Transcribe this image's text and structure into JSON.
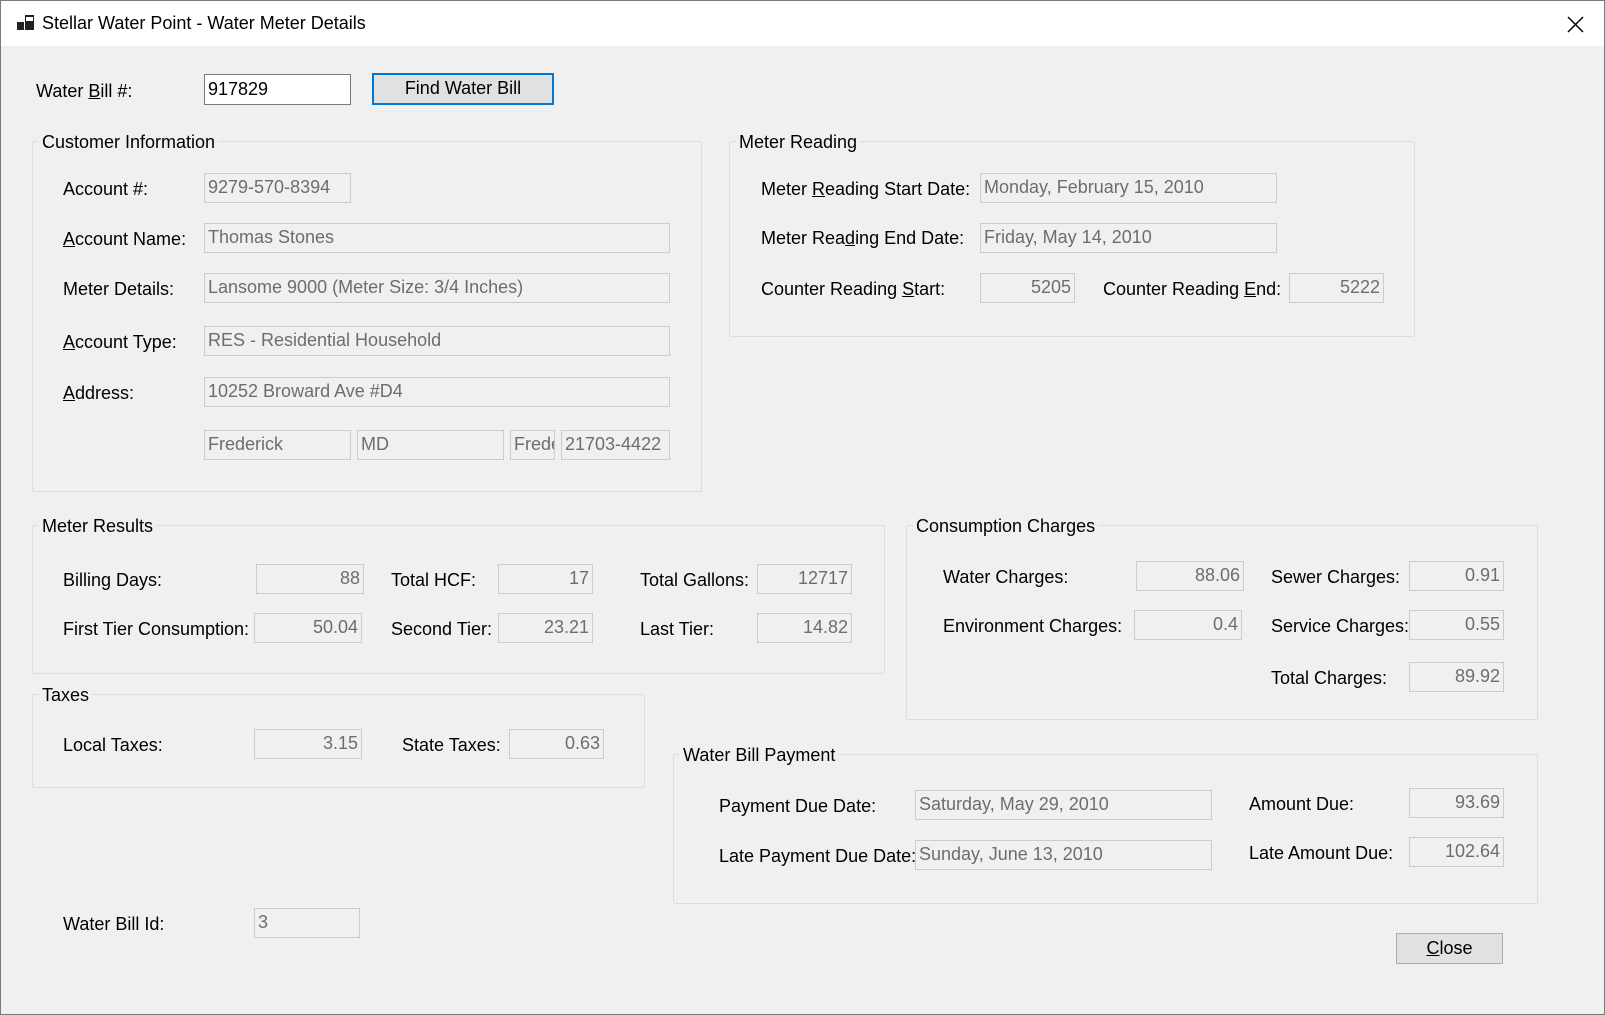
{
  "window": {
    "title": "Stellar Water Point - Water Meter Details"
  },
  "search": {
    "label_pre": "Water ",
    "label_key": "B",
    "label_post": "ill #:",
    "value": "917829",
    "find_button": "Find Water Bill"
  },
  "customer": {
    "group_title": "Customer Information",
    "account_number_label": "Account #:",
    "account_number": "9279-570-8394",
    "account_name_label_key": "A",
    "account_name_label_rest": "ccount Name:",
    "account_name": "Thomas Stones",
    "meter_details_label": "Meter Details:",
    "meter_details": "Lansome 9000 (Meter Size: 3/4 Inches)",
    "account_type_label_key": "A",
    "account_type_label_rest": "ccount Type:",
    "account_type": "RES - Residential Household",
    "address_label_key": "A",
    "address_label_rest": "ddress:",
    "address": "10252 Broward Ave #D4",
    "city": "Frederick",
    "state": "MD",
    "county": "Frede",
    "zip": "21703-4422"
  },
  "meter_reading": {
    "group_title": "Meter Reading",
    "start_date_label_pre": "Meter ",
    "start_date_label_key": "R",
    "start_date_label_post": "eading Start Date:",
    "start_date": "Monday, February 15, 2010",
    "end_date_label_pre": "Meter Rea",
    "end_date_label_key": "d",
    "end_date_label_post": "ing End Date:",
    "end_date": "Friday, May 14, 2010",
    "counter_start_label_pre": "Counter Reading ",
    "counter_start_label_key": "S",
    "counter_start_label_post": "tart:",
    "counter_start": "5205",
    "counter_end_label_pre": "Counter Reading ",
    "counter_end_label_key": "E",
    "counter_end_label_post": "nd:",
    "counter_end": "5222"
  },
  "meter_results": {
    "group_title": "Meter Results",
    "billing_days_label": "Billing Days:",
    "billing_days": "88",
    "total_hcf_label": "Total HCF:",
    "total_hcf": "17",
    "total_gallons_label": "Total Gallons:",
    "total_gallons": "12717",
    "first_tier_label": "First Tier Consumption:",
    "first_tier": "50.04",
    "second_tier_label": "Second Tier:",
    "second_tier": "23.21",
    "last_tier_label": "Last Tier:",
    "last_tier": "14.82"
  },
  "consumption": {
    "group_title": "Consumption Charges",
    "water_label": "Water Charges:",
    "water": "88.06",
    "sewer_label": "Sewer Charges:",
    "sewer": "0.91",
    "environment_label": "Environment Charges:",
    "environment": "0.4",
    "service_label": "Service Charges:",
    "service": "0.55",
    "total_label": "Total Charges:",
    "total": "89.92"
  },
  "taxes": {
    "group_title": "Taxes",
    "local_label": "Local Taxes:",
    "local": "3.15",
    "state_label": "State Taxes:",
    "state": "0.63"
  },
  "payment": {
    "group_title": "Water Bill Payment",
    "due_date_label": "Payment Due Date:",
    "due_date": "Saturday, May 29, 2010",
    "late_due_date_label": "Late Payment Due Date:",
    "late_due_date": "Sunday, June 13, 2010",
    "amount_due_label": "Amount Due:",
    "amount_due": "93.69",
    "late_amount_due_label": "Late Amount Due:",
    "late_amount_due": "102.64"
  },
  "footer": {
    "bill_id_label": "Water Bill Id:",
    "bill_id": "3",
    "close_key": "C",
    "close_rest": "lose"
  }
}
